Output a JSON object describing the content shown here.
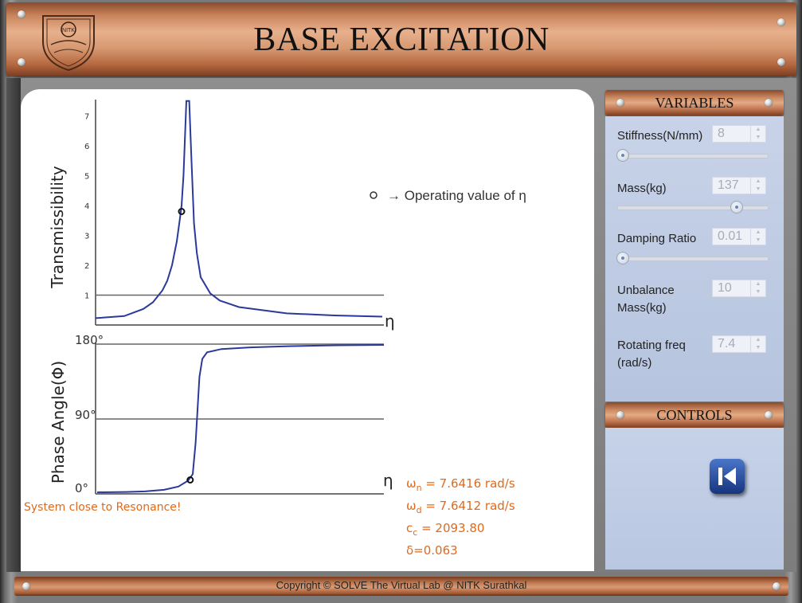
{
  "header": {
    "title": "BASE EXCITATION",
    "logo_text": "NITK"
  },
  "chart_data": [
    {
      "type": "line",
      "ylabel": "Transmissibility",
      "xlabel": "η",
      "yticks": [
        "1",
        "2",
        "3",
        "4",
        "5",
        "6",
        "7"
      ],
      "ylim": [
        0,
        7.3
      ],
      "xlim": [
        0,
        3
      ],
      "reference_line": 1,
      "operating_point": {
        "x": 1.0,
        "y": 3.8
      },
      "series": [
        {
          "points": [
            [
              0,
              0.03
            ],
            [
              0.3,
              0.1
            ],
            [
              0.5,
              0.34
            ],
            [
              0.6,
              0.56
            ],
            [
              0.7,
              0.96
            ],
            [
              0.75,
              1.28
            ],
            [
              0.8,
              1.8
            ],
            [
              0.85,
              2.6
            ],
            [
              0.88,
              3.3
            ],
            [
              0.9,
              3.8
            ],
            [
              0.92,
              4.8
            ],
            [
              0.95,
              7.3
            ],
            [
              0.98,
              7.3
            ],
            [
              1.0,
              5.6
            ],
            [
              1.03,
              3.2
            ],
            [
              1.06,
              2.2
            ],
            [
              1.1,
              1.4
            ],
            [
              1.2,
              0.86
            ],
            [
              1.3,
              0.62
            ],
            [
              1.5,
              0.4
            ],
            [
              2.0,
              0.19
            ],
            [
              2.5,
              0.12
            ],
            [
              3.0,
              0.08
            ]
          ]
        }
      ]
    },
    {
      "type": "line",
      "ylabel": "Phase Angle(Φ)",
      "xlabel": "η",
      "yticks": [
        "0°",
        "90°",
        "180°"
      ],
      "ylim": [
        0,
        180
      ],
      "xlim": [
        0,
        3
      ],
      "operating_point": {
        "x": 1.0,
        "y": 15
      },
      "series": [
        {
          "points": [
            [
              0,
              0
            ],
            [
              0.3,
              0.4
            ],
            [
              0.5,
              1.1
            ],
            [
              0.7,
              3
            ],
            [
              0.85,
              7
            ],
            [
              0.95,
              14
            ],
            [
              1.0,
              22
            ],
            [
              1.03,
              60
            ],
            [
              1.05,
              100
            ],
            [
              1.07,
              140
            ],
            [
              1.1,
              162
            ],
            [
              1.15,
              170
            ],
            [
              1.3,
              174
            ],
            [
              1.6,
              176
            ],
            [
              2.0,
              177.5
            ],
            [
              2.5,
              178.5
            ],
            [
              3.0,
              179
            ]
          ]
        }
      ]
    }
  ],
  "legend": {
    "marker": "○",
    "text": "→ Operating value of η"
  },
  "status": {
    "message": "System close to Resonance!"
  },
  "results": {
    "wn_symbol": "ω",
    "wn_sub": "n",
    "wn_value": " = 7.6416 rad/s",
    "wd_symbol": "ω",
    "wd_sub": "d",
    "wd_value": " = 7.6412 rad/s",
    "cc_symbol": "c",
    "cc_sub": "c",
    "cc_value": " = 2093.80",
    "delta": "δ=0.063"
  },
  "variables": {
    "title": "VARIABLES",
    "stiffness": {
      "label": "Stiffness(N/mm)",
      "value": "8",
      "slider_fraction": 0.0
    },
    "mass": {
      "label": "Mass(kg)",
      "value": "137",
      "slider_fraction": 0.83
    },
    "damping": {
      "label": "Damping Ratio",
      "value": "0.01",
      "slider_fraction": 0.0
    },
    "unbalance": {
      "label_line1": "Unbalance",
      "label_line2": "Mass(kg)",
      "value": "10"
    },
    "rotating": {
      "label_line1": "Rotating freq",
      "label_line2": "(rad/s)",
      "value": "7.4"
    }
  },
  "controls": {
    "title": "CONTROLS",
    "back_icon": "step-back-icon"
  },
  "footer": {
    "copyright": "Copyright © SOLVE The Virtual Lab @ NITK Surathkal"
  },
  "colors": {
    "curve": "#2a3a9a",
    "accent_text": "#e06a1c",
    "header_copper": "#c9855c",
    "panel_blue": "#c8d3e8"
  }
}
